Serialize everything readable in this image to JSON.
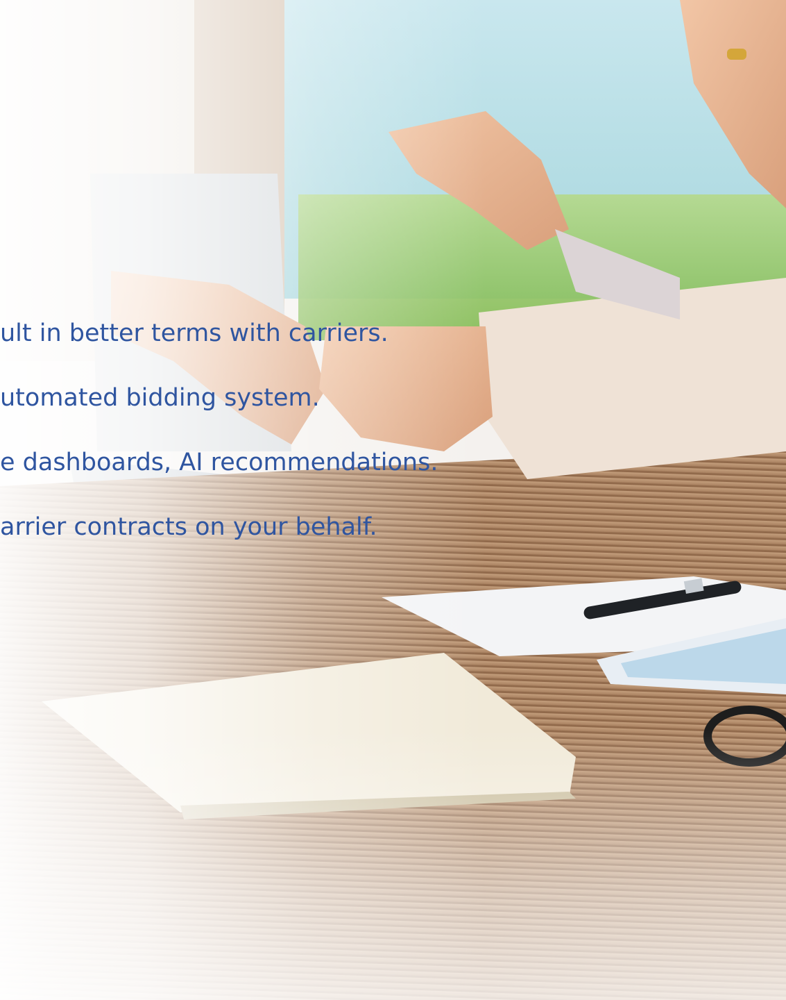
{
  "bullets": [
    {
      "text": "ult in better terms with carriers."
    },
    {
      "text": "utomated bidding system."
    },
    {
      "text": "e dashboards, AI recommendations."
    },
    {
      "text": "arrier contracts on your behalf."
    }
  ],
  "colors": {
    "text": "#2f55a0",
    "background": "#ffffff",
    "table_wood": "#b08562",
    "window_green": "#9ccb63",
    "sleeve_beige": "#efe2d6"
  },
  "photo": {
    "icon": "handshake-photo"
  }
}
